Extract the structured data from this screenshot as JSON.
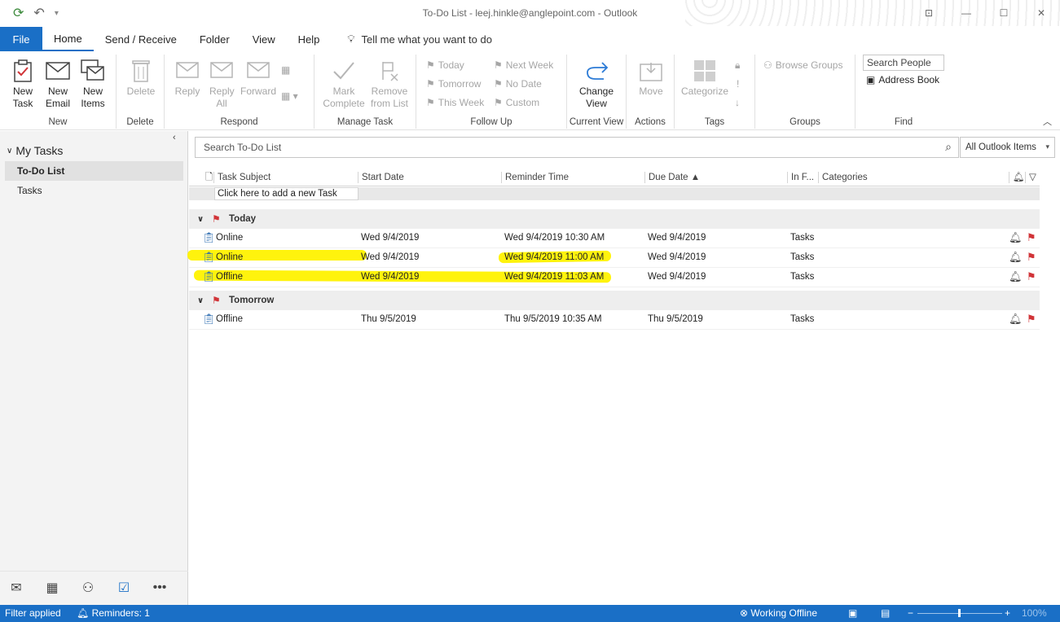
{
  "window": {
    "title": "To-Do List - leej.hinkle@anglepoint.com  -  Outlook"
  },
  "tabs": {
    "file": "File",
    "home": "Home",
    "send_receive": "Send / Receive",
    "folder": "Folder",
    "view": "View",
    "help": "Help",
    "tell_me": "Tell me what you want to do"
  },
  "ribbon": {
    "new": {
      "label": "New",
      "new_task": "New Task",
      "new_email": "New Email",
      "new_items": "New Items"
    },
    "delete": {
      "label": "Delete",
      "delete": "Delete"
    },
    "respond": {
      "label": "Respond",
      "reply": "Reply",
      "reply_all": "Reply All",
      "forward": "Forward"
    },
    "manage_task": {
      "label": "Manage Task",
      "mark_complete": "Mark Complete",
      "remove_from_list": "Remove from List"
    },
    "follow_up": {
      "label": "Follow Up",
      "today": "Today",
      "tomorrow": "Tomorrow",
      "this_week": "This Week",
      "next_week": "Next Week",
      "no_date": "No Date",
      "custom": "Custom"
    },
    "current_view": {
      "label": "Current View",
      "change_view": "Change View"
    },
    "actions": {
      "label": "Actions",
      "move": "Move"
    },
    "tags": {
      "label": "Tags",
      "categorize": "Categorize"
    },
    "groups": {
      "label": "Groups",
      "browse_groups": "Browse Groups"
    },
    "find": {
      "label": "Find",
      "search_people": "Search People",
      "address_book": "Address Book"
    }
  },
  "nav": {
    "my_tasks": "My Tasks",
    "items": [
      {
        "label": "To-Do List",
        "selected": true
      },
      {
        "label": "Tasks",
        "selected": false
      }
    ]
  },
  "search": {
    "placeholder": "Search To-Do List",
    "scope": "All Outlook Items"
  },
  "columns": {
    "task_subject": "Task Subject",
    "start_date": "Start Date",
    "reminder_time": "Reminder Time",
    "due_date": "Due Date",
    "in_folder": "In F...",
    "categories": "Categories"
  },
  "new_task_placeholder": "Click here to add a new Task",
  "groups": [
    {
      "name": "Today",
      "rows": [
        {
          "subject": "Online",
          "start": "Wed 9/4/2019",
          "reminder": "Wed 9/4/2019 10:30 AM",
          "due": "Wed 9/4/2019",
          "folder": "Tasks",
          "highlighted": false
        },
        {
          "subject": "Online",
          "start": "Wed 9/4/2019",
          "reminder": "Wed 9/4/2019 11:00 AM",
          "due": "Wed 9/4/2019",
          "folder": "Tasks",
          "highlighted": true
        },
        {
          "subject": "Offline",
          "start": "Wed 9/4/2019",
          "reminder": "Wed 9/4/2019 11:03 AM",
          "due": "Wed 9/4/2019",
          "folder": "Tasks",
          "highlighted": true
        }
      ]
    },
    {
      "name": "Tomorrow",
      "rows": [
        {
          "subject": "Offline",
          "start": "Thu 9/5/2019",
          "reminder": "Thu 9/5/2019 10:35 AM",
          "due": "Thu 9/5/2019",
          "folder": "Tasks",
          "highlighted": false
        }
      ]
    }
  ],
  "status": {
    "filter": "Filter applied",
    "reminders": "Reminders: 1",
    "offline": "Working Offline",
    "zoom": "100%"
  },
  "colors": {
    "accent": "#1a6fc6",
    "flag": "#d13438",
    "highlight": "#fff200"
  }
}
